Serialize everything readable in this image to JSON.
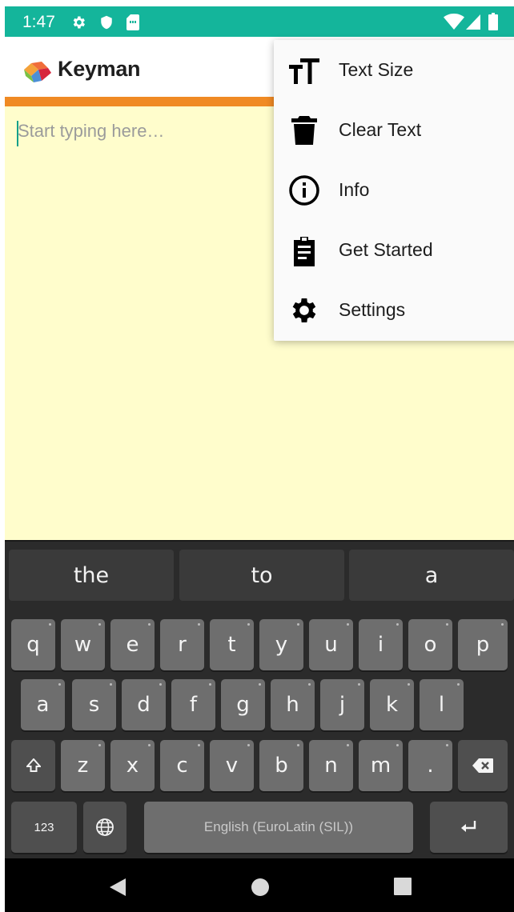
{
  "status_bar": {
    "time": "1:47",
    "icons": [
      "settings-gear-icon",
      "shield-icon",
      "sim-card-icon",
      "wifi-icon",
      "signal-icon",
      "battery-icon"
    ]
  },
  "app": {
    "title": "Keyman",
    "logo": "keyman-logo-icon",
    "colors": {
      "status_bar": "#14b59b",
      "accent": "#f08a24",
      "text_area": "#fffdcc"
    }
  },
  "editor": {
    "placeholder": "Start typing here…"
  },
  "menu": {
    "items": [
      {
        "label": "Text Size",
        "icon": "text-size-icon"
      },
      {
        "label": "Clear Text",
        "icon": "trash-icon"
      },
      {
        "label": "Info",
        "icon": "info-icon"
      },
      {
        "label": "Get Started",
        "icon": "clipboard-icon"
      },
      {
        "label": "Settings",
        "icon": "gear-icon"
      }
    ]
  },
  "keyboard": {
    "suggestions": [
      "the",
      "to",
      "a"
    ],
    "row1": [
      "q",
      "w",
      "e",
      "r",
      "t",
      "y",
      "u",
      "i",
      "o",
      "p"
    ],
    "row2": [
      "a",
      "s",
      "d",
      "f",
      "g",
      "h",
      "j",
      "k",
      "l"
    ],
    "row3": [
      "z",
      "x",
      "c",
      "v",
      "b",
      "n",
      "m",
      "."
    ],
    "numbers_label": "123",
    "space_label": "English (EuroLatin (SIL))"
  },
  "nav_bar": {
    "icons": [
      "back-icon",
      "home-icon",
      "recents-icon"
    ]
  }
}
